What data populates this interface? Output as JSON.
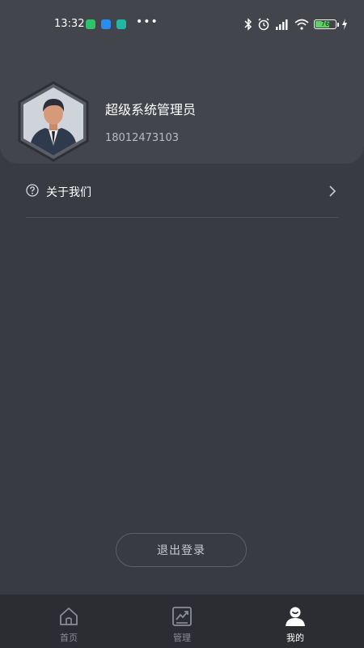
{
  "status_bar": {
    "time": "13:32",
    "battery_level": "76",
    "battery_fraction": 0.76,
    "icons": [
      "chat-app-icon",
      "message-app-icon",
      "shield-app-icon",
      "bluetooth-icon",
      "alarm-icon",
      "signal-icon",
      "wifi-icon",
      "battery-icon",
      "charging-icon"
    ],
    "colors": {
      "chat_app": "#2dc36a",
      "message_app": "#2b8cf0",
      "shield_app": "#20b7a4",
      "battery_fill": "#5fd068"
    }
  },
  "profile": {
    "name": "超级系统管理员",
    "phone": "18012473103",
    "avatar_icon": "user-avatar"
  },
  "menu": {
    "items": [
      {
        "label": "关于我们",
        "icon": "question-circle-icon",
        "trailing_icon": "chevron-right-icon"
      }
    ]
  },
  "logout": {
    "label": "退出登录"
  },
  "tabbar": {
    "tabs": [
      {
        "label": "首页",
        "icon": "home-icon",
        "active": false
      },
      {
        "label": "管理",
        "icon": "chart-icon",
        "active": false
      },
      {
        "label": "我的",
        "icon": "person-icon",
        "active": true
      }
    ]
  },
  "theme": {
    "background": "#393b43",
    "card": "#43454d",
    "tabbar": "#2c2d33",
    "active_tab": "#ffffff",
    "inactive_tab": "#8b8d94"
  }
}
